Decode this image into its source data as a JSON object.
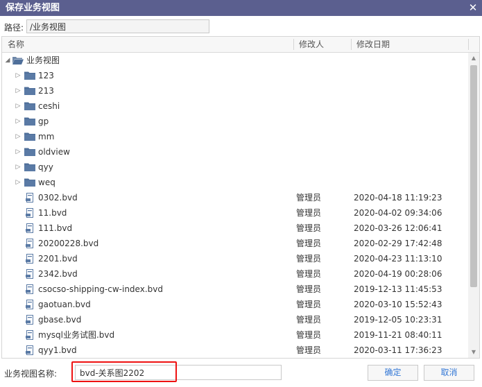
{
  "window": {
    "title": "保存业务视图"
  },
  "path": {
    "label": "路径:",
    "value": "/业务视图"
  },
  "columns": {
    "name": "名称",
    "modifier": "修改人",
    "date": "修改日期"
  },
  "tree": {
    "root": {
      "label": "业务视图"
    },
    "folders": [
      "123",
      "213",
      "ceshi",
      "gp",
      "mm",
      "oldview",
      "qyy",
      "weq"
    ],
    "files": [
      {
        "name": "0302.bvd",
        "modifier": "管理员",
        "date": "2020-04-18 11:19:23"
      },
      {
        "name": "11.bvd",
        "modifier": "管理员",
        "date": "2020-04-02 09:34:06"
      },
      {
        "name": "111.bvd",
        "modifier": "管理员",
        "date": "2020-03-26 12:06:41"
      },
      {
        "name": "20200228.bvd",
        "modifier": "管理员",
        "date": "2020-02-29 17:42:48"
      },
      {
        "name": "2201.bvd",
        "modifier": "管理员",
        "date": "2020-04-23 11:13:10"
      },
      {
        "name": "2342.bvd",
        "modifier": "管理员",
        "date": "2020-04-19 00:28:06"
      },
      {
        "name": "csocso-shipping-cw-index.bvd",
        "modifier": "管理员",
        "date": "2019-12-13 11:45:53"
      },
      {
        "name": "gaotuan.bvd",
        "modifier": "管理员",
        "date": "2020-03-10 15:52:43"
      },
      {
        "name": "gbase.bvd",
        "modifier": "管理员",
        "date": "2019-12-05 10:23:31"
      },
      {
        "name": "mysql业务试图.bvd",
        "modifier": "管理员",
        "date": "2019-11-21 08:40:11"
      },
      {
        "name": "qyy1.bvd",
        "modifier": "管理员",
        "date": "2020-03-11 17:36:23"
      }
    ]
  },
  "bottom": {
    "name_label": "业务视图名称:",
    "name_value": "bvd-关系图2202",
    "ok_label": "确定",
    "cancel_label": "取消"
  },
  "colors": {
    "titlebar": "#5b5f8f",
    "folder": "#4f6f9a",
    "button_text": "#3478d6",
    "highlight": "#ee1111"
  }
}
